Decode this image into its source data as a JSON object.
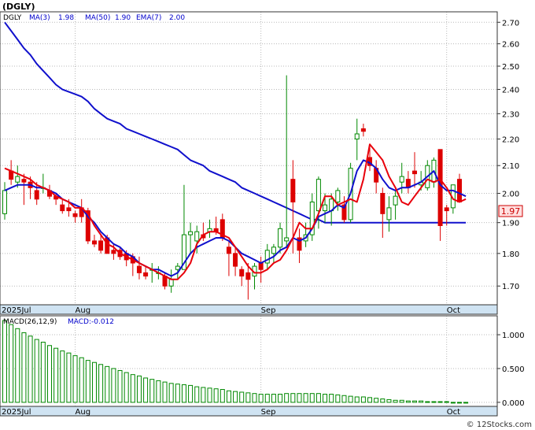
{
  "symbol": "(DGLY)",
  "legend": {
    "ticker": "DGLY",
    "items": [
      {
        "label": "MA(3)",
        "value": "1.98",
        "color": "#e8000b"
      },
      {
        "label": "MA(50)",
        "value": "1.90",
        "color": "#0000dd"
      },
      {
        "label": "EMA(7)",
        "value": "2.00",
        "color": "#0000dd"
      }
    ]
  },
  "macd_legend": {
    "label": "MACD(26,12,9)",
    "value_label": "MACD:-0.012"
  },
  "last_price": "1.97",
  "watermark": "© 12Stocks.com",
  "colors": {
    "up": "#008800",
    "down": "#dd0000",
    "ma3": "#e8000b",
    "ma50": "#1010cc",
    "bg": "#ffffff",
    "axis_band": "#cfe3f2",
    "grid": "#b9b9b9"
  },
  "chart_data": [
    {
      "type": "candlestick",
      "price_axis": {
        "ylim": [
          1.645,
          2.75
        ],
        "ticks": [
          "1.70",
          "1.80",
          "1.90",
          "2.00",
          "2.10",
          "2.20",
          "2.30",
          "2.40",
          "2.50",
          "2.60",
          "2.70"
        ],
        "scale": "log"
      },
      "x_axis_labels": [
        {
          "label": "2025Jul",
          "index": 0
        },
        {
          "label": "Aug",
          "index": 11
        },
        {
          "label": "Sep",
          "index": 40
        },
        {
          "label": "Oct",
          "index": 69
        }
      ],
      "ohlc": [
        [
          1.93,
          2.04,
          1.91,
          2.01
        ],
        [
          2.08,
          2.12,
          2.03,
          2.05
        ],
        [
          2.04,
          2.1,
          2.02,
          2.06
        ],
        [
          2.05,
          2.07,
          1.96,
          2.04
        ],
        [
          2.04,
          2.06,
          1.98,
          2.02
        ],
        [
          2.01,
          2.04,
          1.96,
          1.98
        ],
        [
          2.02,
          2.07,
          2.0,
          2.02
        ],
        [
          2.01,
          2.03,
          1.98,
          1.99
        ],
        [
          1.99,
          2.0,
          1.96,
          1.98
        ],
        [
          1.96,
          1.98,
          1.93,
          1.94
        ],
        [
          1.95,
          1.98,
          1.92,
          1.94
        ],
        [
          1.93,
          1.94,
          1.9,
          1.92
        ],
        [
          1.95,
          1.98,
          1.9,
          1.92
        ],
        [
          1.94,
          1.95,
          1.83,
          1.84
        ],
        [
          1.84,
          1.86,
          1.82,
          1.83
        ],
        [
          1.84,
          1.86,
          1.8,
          1.81
        ],
        [
          1.85,
          1.86,
          1.8,
          1.8
        ],
        [
          1.81,
          1.83,
          1.78,
          1.8
        ],
        [
          1.81,
          1.82,
          1.78,
          1.79
        ],
        [
          1.8,
          1.81,
          1.76,
          1.78
        ],
        [
          1.79,
          1.8,
          1.73,
          1.77
        ],
        [
          1.76,
          1.79,
          1.72,
          1.74
        ],
        [
          1.74,
          1.76,
          1.72,
          1.73
        ],
        [
          1.75,
          1.77,
          1.71,
          1.75
        ],
        [
          1.74,
          1.76,
          1.72,
          1.74
        ],
        [
          1.73,
          1.74,
          1.69,
          1.7
        ],
        [
          1.7,
          1.75,
          1.68,
          1.72
        ],
        [
          1.75,
          1.77,
          1.72,
          1.76
        ],
        [
          1.75,
          2.03,
          1.75,
          1.86
        ],
        [
          1.86,
          1.9,
          1.8,
          1.87
        ],
        [
          1.84,
          1.89,
          1.8,
          1.87
        ],
        [
          1.86,
          1.9,
          1.84,
          1.85
        ],
        [
          1.87,
          1.91,
          1.85,
          1.88
        ],
        [
          1.88,
          1.92,
          1.86,
          1.87
        ],
        [
          1.91,
          1.93,
          1.84,
          1.85
        ],
        [
          1.82,
          1.84,
          1.73,
          1.8
        ],
        [
          1.8,
          1.82,
          1.73,
          1.76
        ],
        [
          1.75,
          1.76,
          1.7,
          1.73
        ],
        [
          1.74,
          1.77,
          1.66,
          1.72
        ],
        [
          1.73,
          1.77,
          1.69,
          1.76
        ],
        [
          1.77,
          1.79,
          1.71,
          1.75
        ],
        [
          1.77,
          1.83,
          1.75,
          1.81
        ],
        [
          1.8,
          1.83,
          1.77,
          1.82
        ],
        [
          1.82,
          1.9,
          1.8,
          1.88
        ],
        [
          1.84,
          2.46,
          1.82,
          1.85
        ],
        [
          2.05,
          2.12,
          1.8,
          1.97
        ],
        [
          1.85,
          1.88,
          1.77,
          1.81
        ],
        [
          1.84,
          1.9,
          1.82,
          1.86
        ],
        [
          1.86,
          2.0,
          1.84,
          1.97
        ],
        [
          1.94,
          2.06,
          1.88,
          2.05
        ],
        [
          1.94,
          2.0,
          1.9,
          1.96
        ],
        [
          1.94,
          2.0,
          1.89,
          1.98
        ],
        [
          1.97,
          2.02,
          1.94,
          2.01
        ],
        [
          1.96,
          1.99,
          1.9,
          1.91
        ],
        [
          1.91,
          2.11,
          1.9,
          2.09
        ],
        [
          2.2,
          2.28,
          2.12,
          2.22
        ],
        [
          2.24,
          2.26,
          2.21,
          2.23
        ],
        [
          2.13,
          2.17,
          2.08,
          2.1
        ],
        [
          2.09,
          2.12,
          2.0,
          2.04
        ],
        [
          2.0,
          2.02,
          1.85,
          1.93
        ],
        [
          1.91,
          1.99,
          1.87,
          1.95
        ],
        [
          1.96,
          2.01,
          1.91,
          1.99
        ],
        [
          2.04,
          2.11,
          2.0,
          2.06
        ],
        [
          2.05,
          2.08,
          2.0,
          2.02
        ],
        [
          2.08,
          2.15,
          2.02,
          2.07
        ],
        [
          2.03,
          2.08,
          2.01,
          2.04
        ],
        [
          2.02,
          2.12,
          2.01,
          2.1
        ],
        [
          2.04,
          2.13,
          2.02,
          2.12
        ],
        [
          2.16,
          2.16,
          1.84,
          1.89
        ],
        [
          1.95,
          1.96,
          1.89,
          1.94
        ],
        [
          1.95,
          2.03,
          1.93,
          2.03
        ],
        [
          2.05,
          2.07,
          1.97,
          1.97
        ]
      ],
      "ma3": [
        2.09,
        2.08,
        2.07,
        2.06,
        2.05,
        2.03,
        2.02,
        2.01,
        1.99,
        1.98,
        1.97,
        1.95,
        1.95,
        1.93,
        1.89,
        1.86,
        1.83,
        1.82,
        1.8,
        1.79,
        1.78,
        1.77,
        1.76,
        1.75,
        1.74,
        1.73,
        1.72,
        1.72,
        1.74,
        1.77,
        1.83,
        1.86,
        1.87,
        1.87,
        1.86,
        1.85,
        1.82,
        1.79,
        1.76,
        1.74,
        1.74,
        1.75,
        1.77,
        1.78,
        1.81,
        1.85,
        1.9,
        1.88,
        1.88,
        1.93,
        1.99,
        1.99,
        1.96,
        1.97,
        1.98,
        1.97,
        2.05,
        2.18,
        2.15,
        2.12,
        2.06,
        2.02,
        1.97,
        1.96,
        1.99,
        2.02,
        2.05,
        2.04,
        2.05,
        2.02,
        1.98,
        1.97,
        1.98
      ],
      "ema7": [
        2.01,
        2.02,
        2.03,
        2.03,
        2.03,
        2.02,
        2.02,
        2.01,
        2.0,
        1.98,
        1.97,
        1.96,
        1.95,
        1.92,
        1.9,
        1.87,
        1.85,
        1.83,
        1.82,
        1.8,
        1.79,
        1.77,
        1.76,
        1.75,
        1.75,
        1.74,
        1.73,
        1.74,
        1.77,
        1.8,
        1.82,
        1.83,
        1.84,
        1.85,
        1.85,
        1.84,
        1.82,
        1.8,
        1.79,
        1.78,
        1.77,
        1.78,
        1.79,
        1.81,
        1.82,
        1.85,
        1.84,
        1.85,
        1.88,
        1.92,
        1.93,
        1.94,
        1.96,
        1.95,
        2.0,
        2.08,
        2.12,
        2.11,
        2.09,
        2.05,
        2.02,
        2.01,
        2.02,
        2.02,
        2.03,
        2.04,
        2.06,
        2.08,
        2.03,
        2.01,
        2.01,
        2.0,
        1.99
      ],
      "ma50": [
        2.7,
        2.66,
        2.62,
        2.58,
        2.55,
        2.51,
        2.48,
        2.45,
        2.42,
        2.4,
        2.39,
        2.38,
        2.37,
        2.35,
        2.32,
        2.3,
        2.28,
        2.27,
        2.26,
        2.24,
        2.23,
        2.22,
        2.21,
        2.2,
        2.19,
        2.18,
        2.17,
        2.16,
        2.14,
        2.12,
        2.11,
        2.1,
        2.08,
        2.07,
        2.06,
        2.05,
        2.04,
        2.02,
        2.01,
        2.0,
        1.99,
        1.98,
        1.97,
        1.96,
        1.95,
        1.94,
        1.93,
        1.92,
        1.91,
        1.91,
        1.9,
        1.9,
        1.9,
        1.9,
        1.9,
        1.9,
        1.9,
        1.9,
        1.9,
        1.9,
        1.9,
        1.9,
        1.9,
        1.9,
        1.9,
        1.9,
        1.9,
        1.9,
        1.9,
        1.9,
        1.9,
        1.9,
        1.9
      ]
    },
    {
      "type": "bar",
      "title": "MACD(26,12,9)",
      "ylim": [
        -0.06,
        1.28
      ],
      "ticks": [
        "0.000",
        "0.500",
        "1.000"
      ],
      "x_axis_labels": [
        "2025Jul",
        "Aug",
        "Sep",
        "Oct"
      ],
      "values": [
        1.21,
        1.15,
        1.09,
        1.03,
        0.98,
        0.93,
        0.89,
        0.84,
        0.8,
        0.76,
        0.73,
        0.69,
        0.66,
        0.62,
        0.59,
        0.56,
        0.53,
        0.5,
        0.47,
        0.44,
        0.41,
        0.39,
        0.36,
        0.34,
        0.32,
        0.3,
        0.28,
        0.27,
        0.26,
        0.25,
        0.23,
        0.22,
        0.21,
        0.2,
        0.19,
        0.17,
        0.16,
        0.15,
        0.14,
        0.13,
        0.12,
        0.12,
        0.12,
        0.12,
        0.13,
        0.13,
        0.13,
        0.13,
        0.13,
        0.13,
        0.12,
        0.12,
        0.11,
        0.1,
        0.09,
        0.08,
        0.08,
        0.07,
        0.06,
        0.05,
        0.04,
        0.03,
        0.03,
        0.02,
        0.02,
        0.02,
        0.01,
        0.01,
        0.01,
        0.01,
        0.0,
        0.0,
        -0.012
      ]
    }
  ]
}
